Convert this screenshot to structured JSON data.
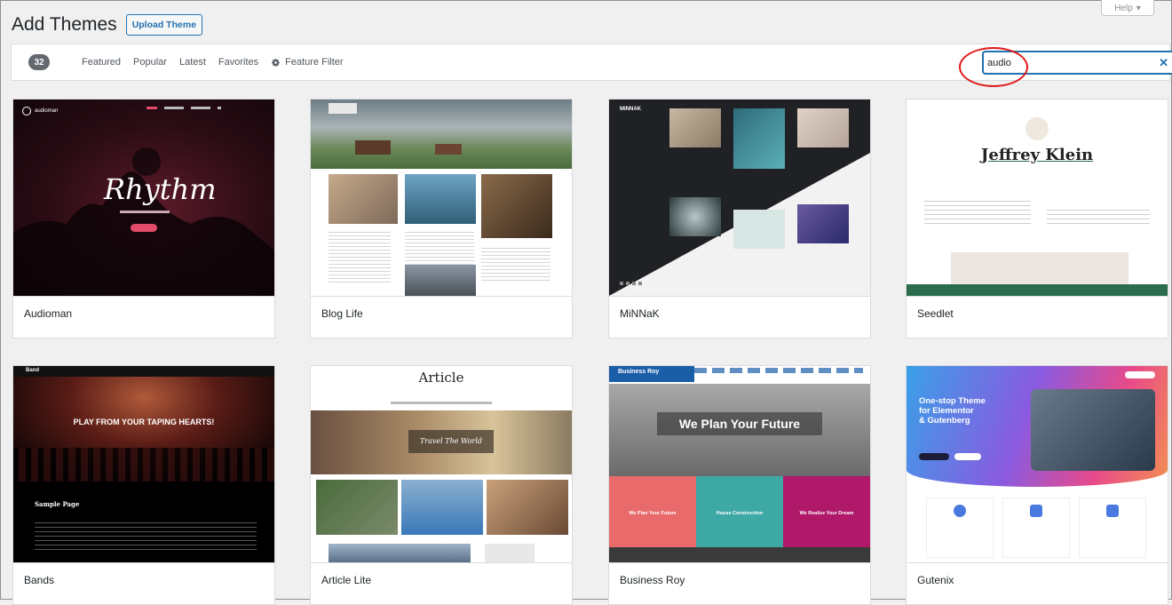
{
  "header": {
    "title": "Add Themes",
    "upload_label": "Upload Theme",
    "help_label": "Help"
  },
  "filters": {
    "count": "32",
    "links": [
      "Featured",
      "Popular",
      "Latest",
      "Favorites"
    ],
    "feature_filter": "Feature Filter"
  },
  "search": {
    "value": "audio",
    "clear_icon": "close-icon"
  },
  "themes": [
    {
      "name": "Audioman",
      "thumb_text": {
        "logo": "audioman",
        "title": "Rhythm"
      }
    },
    {
      "name": "Blog Life"
    },
    {
      "name": "MiNNaK",
      "thumb_text": {
        "logo": "MINNAK"
      }
    },
    {
      "name": "Seedlet",
      "thumb_text": {
        "title": "Jeffrey Klein"
      }
    },
    {
      "name": "Bands",
      "thumb_text": {
        "logo": "Band",
        "hero": "PLAY FROM YOUR TAPING HEARTS!",
        "sample": "Sample Page"
      }
    },
    {
      "name": "Article Lite",
      "thumb_text": {
        "title": "Article",
        "overlay": "Travel The World"
      }
    },
    {
      "name": "Business Roy",
      "thumb_text": {
        "logo": "Business Roy",
        "hero": "We Plan Your Future",
        "box1": "We Plan Your Future",
        "box2": "House Construction",
        "box3": "We Realize Your Dream"
      }
    },
    {
      "name": "Gutenix",
      "thumb_text": {
        "hero_line1": "One-stop Theme",
        "hero_line2": "for Elementor",
        "hero_line3": "& Gutenberg"
      }
    }
  ],
  "colors": {
    "accent": "#2271b1",
    "highlight": "#e0191b",
    "count_badge": "#646970"
  }
}
